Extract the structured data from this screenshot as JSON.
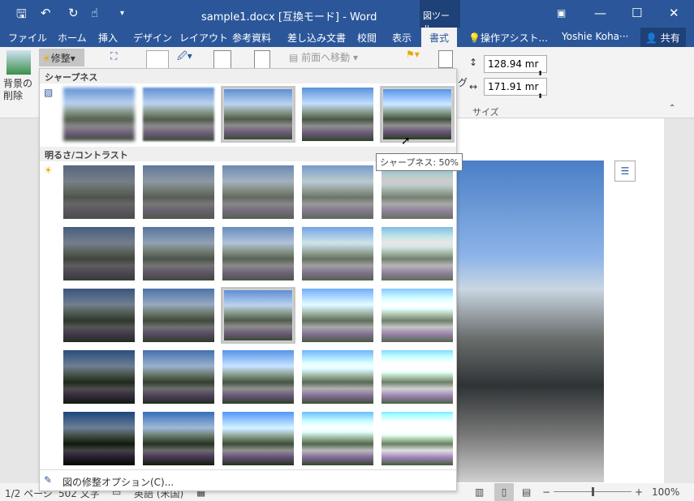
{
  "title_bar": {
    "title": "sample1.docx [互換モード] - Word",
    "context_tab": "図ツール",
    "quick_access": [
      "save-icon",
      "undo-icon",
      "redo-icon",
      "touch-mode-icon",
      "customize-icon"
    ],
    "window_controls": [
      "ribbon-display-icon",
      "minimize-icon",
      "maximize-icon",
      "close-icon"
    ]
  },
  "tabs": [
    {
      "label": "ファイル"
    },
    {
      "label": "ホーム"
    },
    {
      "label": "挿入"
    },
    {
      "label": "デザイン"
    },
    {
      "label": "レイアウト"
    },
    {
      "label": "参考資料"
    },
    {
      "label": "差し込み文書"
    },
    {
      "label": "校閲"
    },
    {
      "label": "表示"
    },
    {
      "label": "書式",
      "active": true
    }
  ],
  "tell_me": "操作アシスト...",
  "user": "Yoshie Koha···",
  "share": "共有",
  "ribbon": {
    "remove_bg": "背景の削除",
    "corrections": "修整",
    "bring_forward": "前面へ移動",
    "height": "128.94 mr",
    "width": "171.91 mr",
    "size_group": "サイズ",
    "partial": "グ"
  },
  "gallery": {
    "sharpness_title": "シャープネス",
    "brightness_title": "明るさ/コントラスト",
    "tooltip": "シャープネス: 50%",
    "options_label": "図の修整オプション(C)...",
    "sharpness": [
      -50,
      -25,
      0,
      25,
      50
    ],
    "sharpness_selected": 2,
    "sharpness_hover": 4,
    "brightness": [
      -40,
      -20,
      0,
      20,
      40
    ],
    "contrast": [
      -40,
      -20,
      0,
      20,
      40
    ],
    "bc_selected": [
      2,
      2
    ]
  },
  "status": {
    "page": "1/2 ページ",
    "words": "502 文字",
    "language": "英語 (米国)",
    "zoom": "100%",
    "zoom_level": 100
  }
}
